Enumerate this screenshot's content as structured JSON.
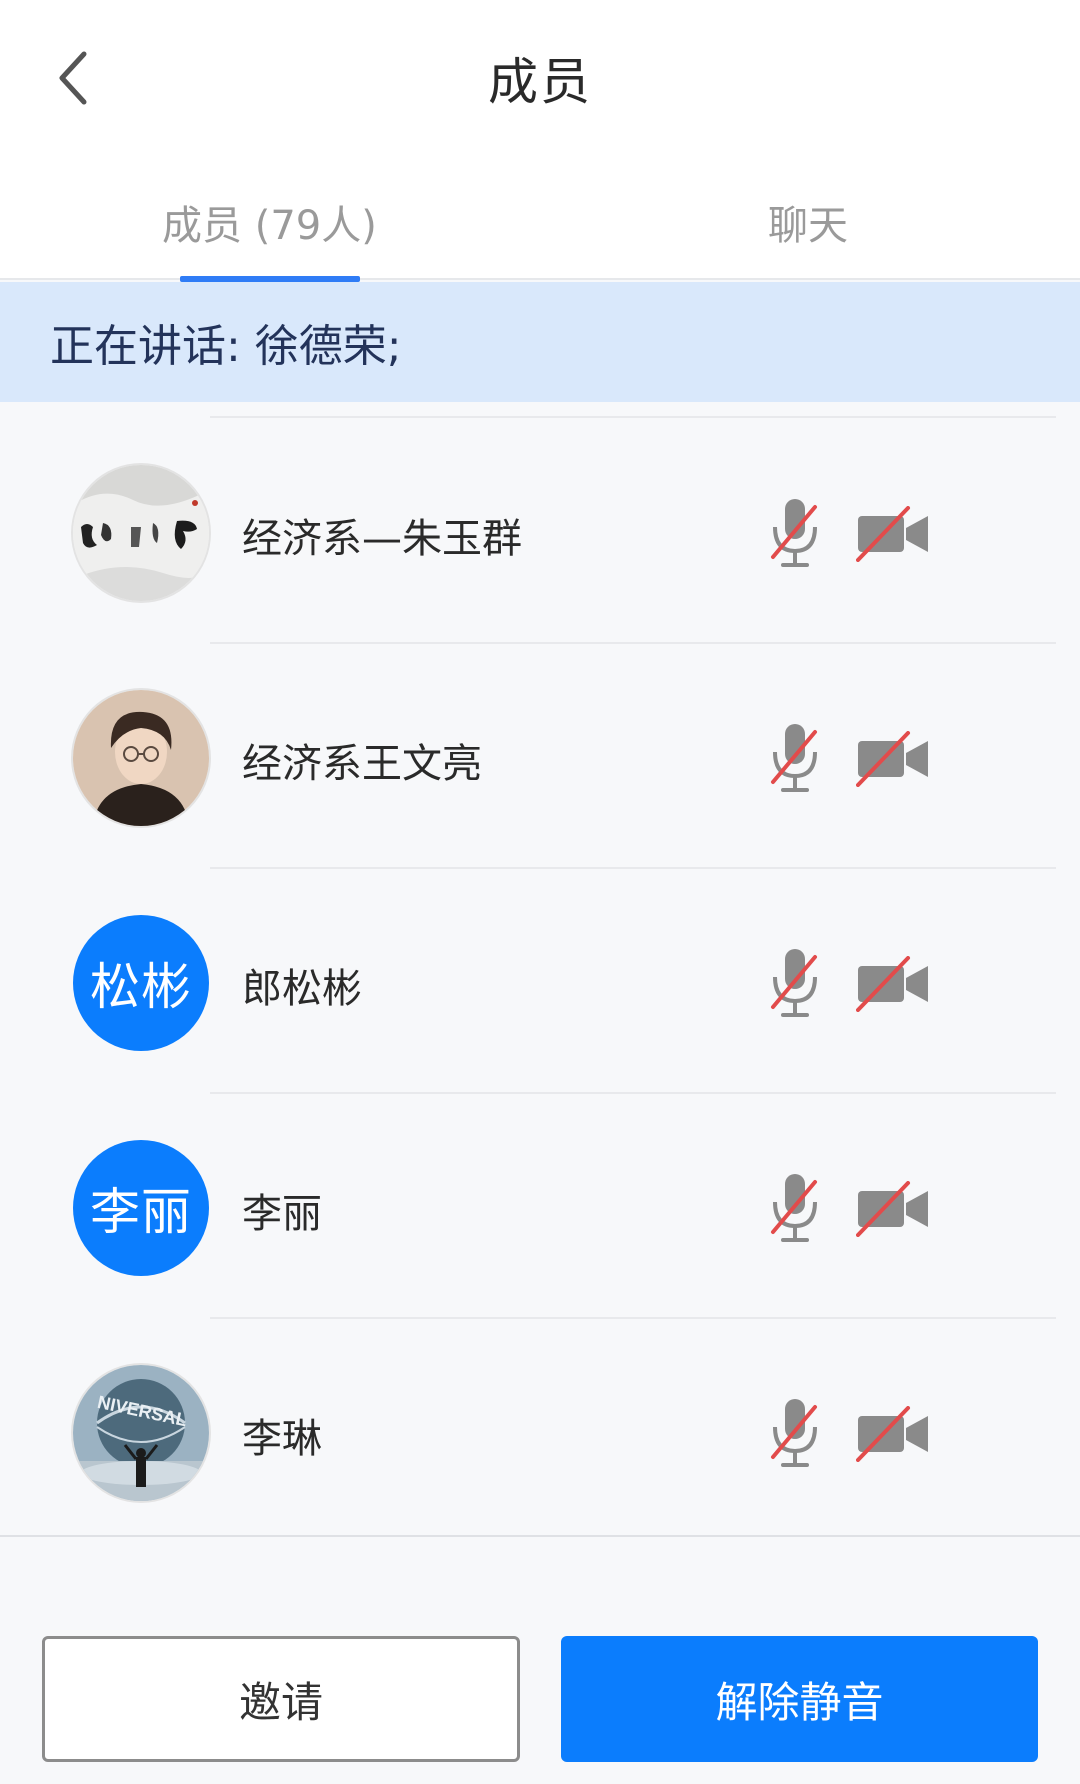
{
  "header": {
    "title": "成员"
  },
  "tabs": [
    {
      "label": "成员 (79人)"
    },
    {
      "label": "聊天"
    }
  ],
  "speaking": {
    "text": "正在讲话: 徐德荣;"
  },
  "members": [
    {
      "name": "经济系—朱玉群",
      "avatar_type": "calligraphy-image",
      "mic": "muted",
      "camera": "off"
    },
    {
      "name": "经济系王文亮",
      "avatar_type": "illustrated-person",
      "mic": "muted",
      "camera": "off"
    },
    {
      "name": "郎松彬",
      "avatar_text": "松彬",
      "avatar_type": "initials",
      "mic": "muted",
      "camera": "off"
    },
    {
      "name": "李丽",
      "avatar_text": "李丽",
      "avatar_type": "initials",
      "mic": "muted",
      "camera": "off"
    },
    {
      "name": "李琳",
      "avatar_type": "universal-globe-photo",
      "mic": "muted",
      "camera": "off"
    }
  ],
  "footer": {
    "invite_label": "邀请",
    "unmute_label": "解除静音"
  },
  "colors": {
    "accent": "#0b7dfd",
    "speaking_bg": "#d9e8fb",
    "mute_slash": "#e24b4b",
    "icon_gray": "#8a8a8a"
  }
}
